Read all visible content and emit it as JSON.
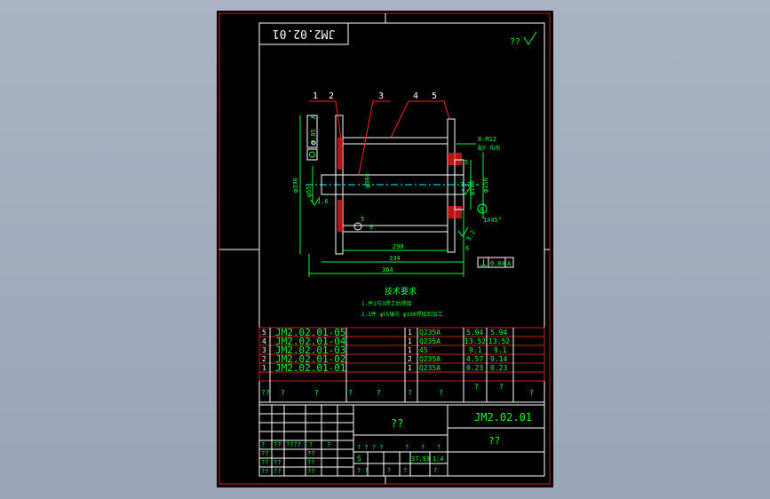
{
  "drawing": {
    "number_rotated": "JM2.02.01",
    "corner_mark": "??",
    "datum_tol_value": "0.05",
    "datum_tol_ref": "A",
    "perp_tol_value": "0.04",
    "perp_tol_ref": "A",
    "thread_note": "8-M12",
    "thread_note2": "配F 均布",
    "chamfer": "1X45°",
    "balloons": [
      "1",
      "2",
      "3",
      "4",
      "5"
    ],
    "dims": {
      "d336": "φ336",
      "d55": "φ55",
      "d304": "φ304",
      "d100": "φ100",
      "d150": "φ150",
      "len298": "298",
      "len334": "334",
      "len364": "364",
      "r16": "1.6",
      "r32a": "3.2",
      "r32b": "3.2",
      "n5a": "5",
      "n5b": "5",
      "n6a": "6",
      "n6b": "6",
      "ref_a": "A"
    },
    "notes_title": "技术要求",
    "notes": [
      "1.件2与3焊工后焊接",
      "2.3件 φ55轴与 φ100焊接后加工"
    ]
  },
  "bom": [
    {
      "no": "5",
      "code": "JM2.02.01-05",
      "qty": "1",
      "mat": "Q235A",
      "unit": "5.94",
      "total": "5.94"
    },
    {
      "no": "4",
      "code": "JM2.02.01-04",
      "qty": "1",
      "mat": "Q235A",
      "unit": "13.52",
      "total": "13.52"
    },
    {
      "no": "3",
      "code": "JM2.02.01-03",
      "qty": "1",
      "mat": "45",
      "unit": "9.1",
      "total": "9.1"
    },
    {
      "no": "2",
      "code": "JM2.02.01-02",
      "qty": "2",
      "mat": "Q235A",
      "unit": "4.57",
      "total": "9.14"
    },
    {
      "no": "1",
      "code": "JM2.02.01-01",
      "qty": "1",
      "mat": "Q235A",
      "unit": "0.23",
      "total": "0.23"
    }
  ],
  "bom_header": [
    "??",
    "?",
    "?",
    "?",
    "?",
    "?",
    "?",
    "?",
    "?",
    "?"
  ],
  "title_block": {
    "drawing_name": "??",
    "drawing_number": "JM2.02.01",
    "company": "??",
    "sign_labels": [
      "??",
      "??",
      "??",
      "??",
      "??",
      "??",
      "??",
      "??"
    ],
    "sign_row": [
      "?",
      "??",
      "????",
      "?",
      "?"
    ],
    "grade_labels": [
      "? ? ? ?",
      "?",
      "?",
      "?"
    ],
    "scale_vals": [
      "S",
      "37.93",
      "1:4"
    ],
    "sheet_labels": [
      "? ?",
      "?",
      "?",
      "?"
    ]
  },
  "colors": {
    "background": "#000000",
    "frame": "#cc2020",
    "line": "#ffffff",
    "dim": "#00ff33",
    "section": "#ff2020",
    "center": "#00ffff"
  }
}
